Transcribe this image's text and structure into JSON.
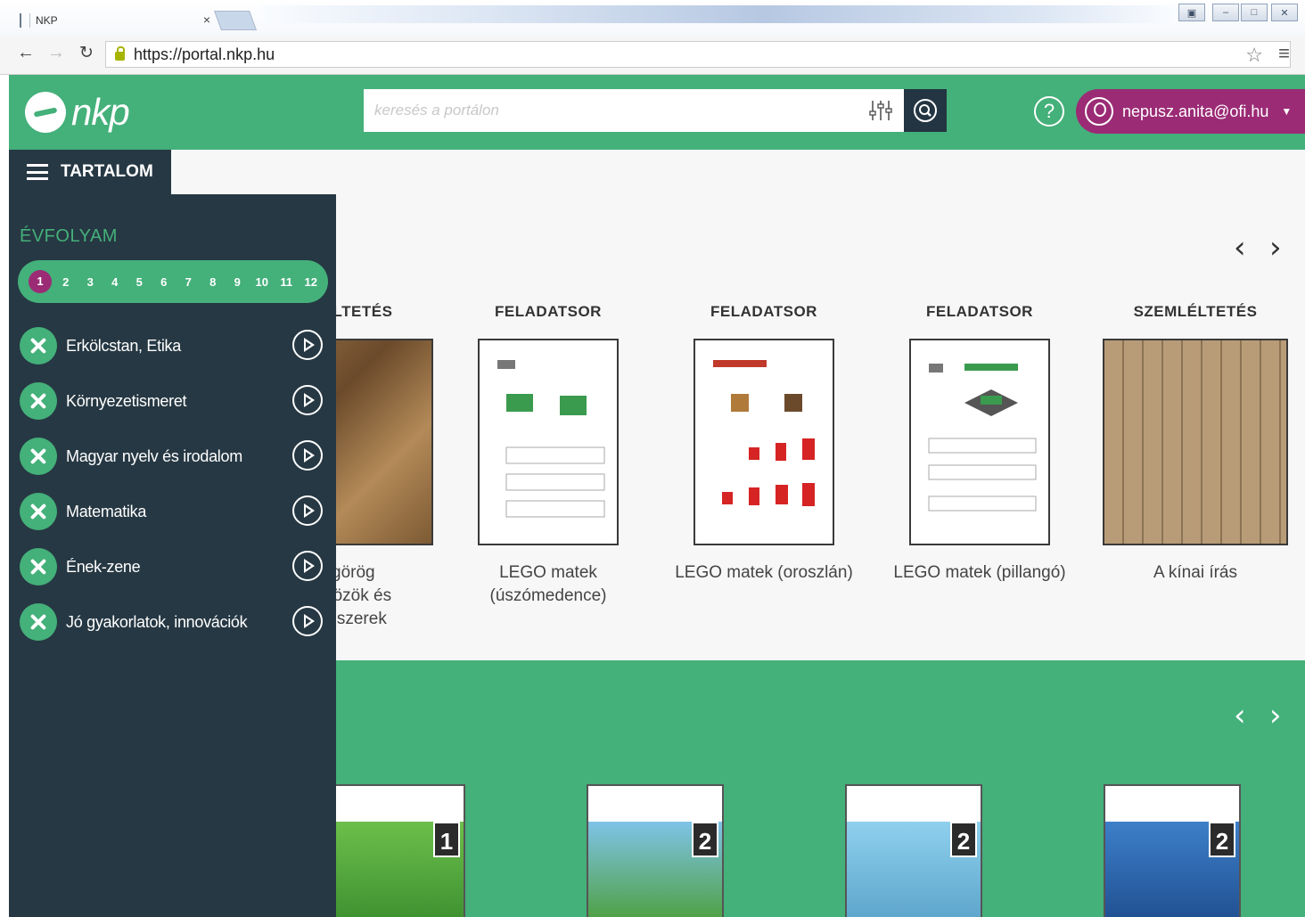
{
  "browser": {
    "tab_title": "NKP",
    "tab_close": "×",
    "url": "https://portal.nkp.hu"
  },
  "header": {
    "logo_text": "nkp",
    "search_placeholder": "keresés a portálon",
    "user_email": "nepusz.anita@ofi.hu",
    "help_glyph": "?",
    "brand_color": "#44b07a",
    "accent_color": "#9b2b75",
    "dark_color": "#263843"
  },
  "sidebar": {
    "tab_label": "TARTALOM",
    "grade_label": "ÉVFOLYAM",
    "grades": [
      "1",
      "2",
      "3",
      "4",
      "5",
      "6",
      "7",
      "8",
      "9",
      "10",
      "11",
      "12"
    ],
    "active_grade": "1",
    "subjects": [
      {
        "label": "Erkölcstan, Etika"
      },
      {
        "label": "Környezetismeret"
      },
      {
        "label": "Magyar nyelv és irodalom"
      },
      {
        "label": "Matematika"
      },
      {
        "label": "Ének-zene"
      },
      {
        "label": "Jó gyakorlatok, innovációk"
      }
    ]
  },
  "carousel": {
    "prev": "‹",
    "next": "›",
    "cards": [
      {
        "type": "SZEMLÉLTETÉS",
        "title_lines": [
          "Ókori görög",
          "íráseszközök és írásrendszerek"
        ]
      },
      {
        "type": "FELADATSOR",
        "title_lines": [
          "LEGO matek",
          "(úszómedence)"
        ]
      },
      {
        "type": "FELADATSOR",
        "title_lines": [
          "LEGO matek (oroszlán)"
        ]
      },
      {
        "type": "FELADATSOR",
        "title_lines": [
          "LEGO matek (pillangó)"
        ]
      },
      {
        "type": "SZEMLÉLTETÉS",
        "title_lines": [
          "A kínai írás"
        ]
      }
    ]
  },
  "books": {
    "prev": "‹",
    "next": "›",
    "items": [
      {
        "grade": "1"
      },
      {
        "grade": "2"
      },
      {
        "grade": "2"
      },
      {
        "grade": "2"
      }
    ]
  }
}
